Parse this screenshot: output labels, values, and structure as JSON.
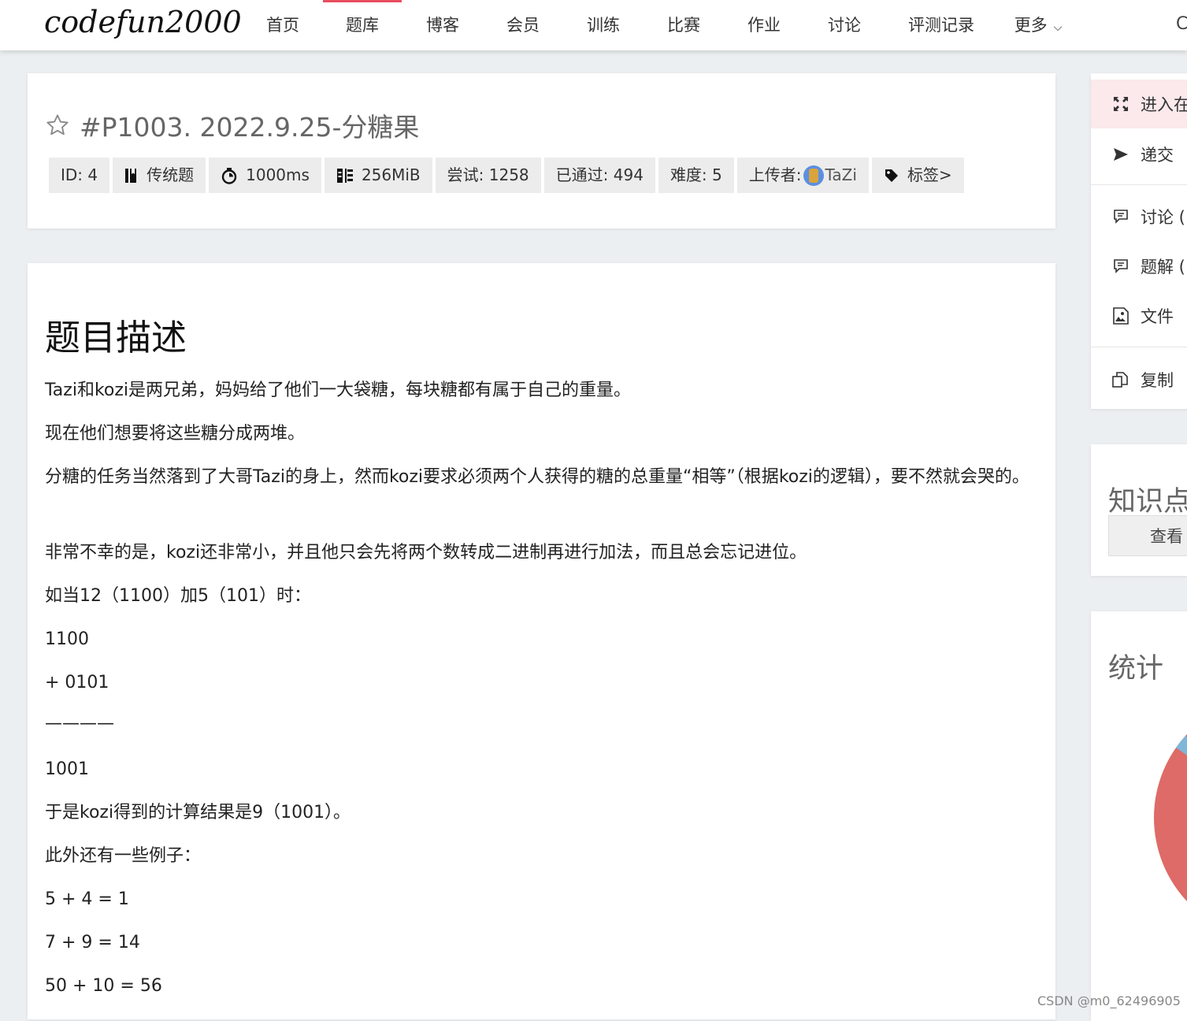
{
  "logo": "codefun2000",
  "nav": {
    "items": [
      "首页",
      "题库",
      "博客",
      "会员",
      "训练",
      "比赛",
      "作业",
      "讨论",
      "评测记录",
      "更多"
    ],
    "active": "题库",
    "more_chevron": "chevron-down-icon",
    "right_cut": "C"
  },
  "problem": {
    "title": "#P1003. 2022.9.25-分糖果",
    "badges": {
      "id": "ID: 4",
      "type": "传统题",
      "time": "1000ms",
      "memory": "256MiB",
      "tried": "尝试: 1258",
      "passed": "已通过: 494",
      "difficulty": "难度: 5",
      "uploader_label": "上传者:",
      "uploader_name": "TaZi",
      "tags": "标签>"
    }
  },
  "description": {
    "heading": "题目描述",
    "paragraphs": [
      "Tazi和kozi是两兄弟，妈妈给了他们一大袋糖，每块糖都有属于自己的重量。",
      "现在他们想要将这些糖分成两堆。",
      "分糖的任务当然落到了大哥Tazi的身上，然而kozi要求必须两个人获得的糖的总重量“相等”（根据kozi的逻辑），要不然就会哭的。",
      "非常不幸的是，kozi还非常小，并且他只会先将两个数转成二进制再进行加法，而且总会忘记进位。",
      "如当12（1100）加5（101）时：",
      "1100",
      "+ 0101",
      "————",
      "1001",
      "于是kozi得到的计算结果是9（1001）。",
      "此外还有一些例子：",
      "5 + 4 = 1",
      "7 + 9 = 14",
      "50 + 10 = 56"
    ]
  },
  "sidebar": {
    "menu": [
      {
        "label": "进入在",
        "icon": "fullscreen-icon"
      },
      {
        "label": "递交",
        "icon": "send-icon"
      },
      {
        "label": "讨论 (",
        "icon": "comment-icon"
      },
      {
        "label": "题解 (",
        "icon": "comment-icon"
      },
      {
        "label": "文件",
        "icon": "image-file-icon"
      },
      {
        "label": "复制",
        "icon": "copy-icon"
      }
    ],
    "knowledge_title": "知识点",
    "view_button": "查看",
    "stats_title": "统计"
  },
  "colors": {
    "accent": "#e94d5e",
    "pie_red": "#de6b67",
    "pie_blue": "#7fb6d9"
  },
  "watermark": "CSDN @m0_62496905"
}
